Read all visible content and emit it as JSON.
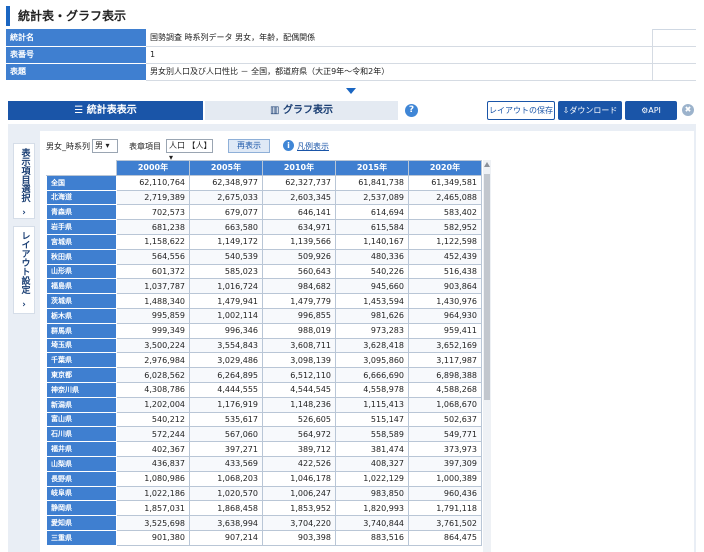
{
  "page": {
    "title": "統計表・グラフ表示"
  },
  "info_rows": [
    {
      "label": "統計名",
      "value": "国勢調査 時系列データ 男女，年齢，配偶関係"
    },
    {
      "label": "表番号",
      "value": "1"
    },
    {
      "label": "表題",
      "value": "男女別人口及び人口性比 － 全国，都道府県（大正9年～令和2年）"
    }
  ],
  "tabs": {
    "table": "統計表表示",
    "graph": "グラフ表示"
  },
  "buttons": {
    "help": "?",
    "layout_save": "レイアウトの保存",
    "download": "ダウンロード",
    "api": "API",
    "close": "✖"
  },
  "side_tabs": {
    "item_select": "表示項目選択",
    "layout": "レイアウト設定",
    "arrow": "›"
  },
  "filters": {
    "sex_label": "男女_時系列",
    "sex_value": "男",
    "item_label": "表章項目",
    "item_value": "人口 【人】",
    "redraw": "再表示",
    "legend": "凡例表示",
    "legend_icon": "i"
  },
  "table": {
    "columns": [
      "2000年",
      "2005年",
      "2010年",
      "2015年",
      "2020年"
    ],
    "rows": [
      {
        "label": "全国",
        "values": [
          "62,110,764",
          "62,348,977",
          "62,327,737",
          "61,841,738",
          "61,349,581"
        ]
      },
      {
        "label": "北海道",
        "values": [
          "2,719,389",
          "2,675,033",
          "2,603,345",
          "2,537,089",
          "2,465,088"
        ]
      },
      {
        "label": "青森県",
        "values": [
          "702,573",
          "679,077",
          "646,141",
          "614,694",
          "583,402"
        ]
      },
      {
        "label": "岩手県",
        "values": [
          "681,238",
          "663,580",
          "634,971",
          "615,584",
          "582,952"
        ]
      },
      {
        "label": "宮城県",
        "values": [
          "1,158,622",
          "1,149,172",
          "1,139,566",
          "1,140,167",
          "1,122,598"
        ]
      },
      {
        "label": "秋田県",
        "values": [
          "564,556",
          "540,539",
          "509,926",
          "480,336",
          "452,439"
        ]
      },
      {
        "label": "山形県",
        "values": [
          "601,372",
          "585,023",
          "560,643",
          "540,226",
          "516,438"
        ]
      },
      {
        "label": "福島県",
        "values": [
          "1,037,787",
          "1,016,724",
          "984,682",
          "945,660",
          "903,864"
        ]
      },
      {
        "label": "茨城県",
        "values": [
          "1,488,340",
          "1,479,941",
          "1,479,779",
          "1,453,594",
          "1,430,976"
        ]
      },
      {
        "label": "栃木県",
        "values": [
          "995,859",
          "1,002,114",
          "996,855",
          "981,626",
          "964,930"
        ]
      },
      {
        "label": "群馬県",
        "values": [
          "999,349",
          "996,346",
          "988,019",
          "973,283",
          "959,411"
        ]
      },
      {
        "label": "埼玉県",
        "values": [
          "3,500,224",
          "3,554,843",
          "3,608,711",
          "3,628,418",
          "3,652,169"
        ]
      },
      {
        "label": "千葉県",
        "values": [
          "2,976,984",
          "3,029,486",
          "3,098,139",
          "3,095,860",
          "3,117,987"
        ]
      },
      {
        "label": "東京都",
        "values": [
          "6,028,562",
          "6,264,895",
          "6,512,110",
          "6,666,690",
          "6,898,388"
        ]
      },
      {
        "label": "神奈川県",
        "values": [
          "4,308,786",
          "4,444,555",
          "4,544,545",
          "4,558,978",
          "4,588,268"
        ]
      },
      {
        "label": "新潟県",
        "values": [
          "1,202,004",
          "1,176,919",
          "1,148,236",
          "1,115,413",
          "1,068,670"
        ]
      },
      {
        "label": "富山県",
        "values": [
          "540,212",
          "535,617",
          "526,605",
          "515,147",
          "502,637"
        ]
      },
      {
        "label": "石川県",
        "values": [
          "572,244",
          "567,060",
          "564,972",
          "558,589",
          "549,771"
        ]
      },
      {
        "label": "福井県",
        "values": [
          "402,367",
          "397,271",
          "389,712",
          "381,474",
          "373,973"
        ]
      },
      {
        "label": "山梨県",
        "values": [
          "436,837",
          "433,569",
          "422,526",
          "408,327",
          "397,309"
        ]
      },
      {
        "label": "長野県",
        "values": [
          "1,080,986",
          "1,068,203",
          "1,046,178",
          "1,022,129",
          "1,000,389"
        ]
      },
      {
        "label": "岐阜県",
        "values": [
          "1,022,186",
          "1,020,570",
          "1,006,247",
          "983,850",
          "960,436"
        ]
      },
      {
        "label": "静岡県",
        "values": [
          "1,857,031",
          "1,868,458",
          "1,853,952",
          "1,820,993",
          "1,791,118"
        ]
      },
      {
        "label": "愛知県",
        "values": [
          "3,525,698",
          "3,638,994",
          "3,704,220",
          "3,740,844",
          "3,761,502"
        ]
      },
      {
        "label": "三重県",
        "values": [
          "901,380",
          "907,214",
          "903,398",
          "883,516",
          "864,475"
        ]
      }
    ]
  }
}
